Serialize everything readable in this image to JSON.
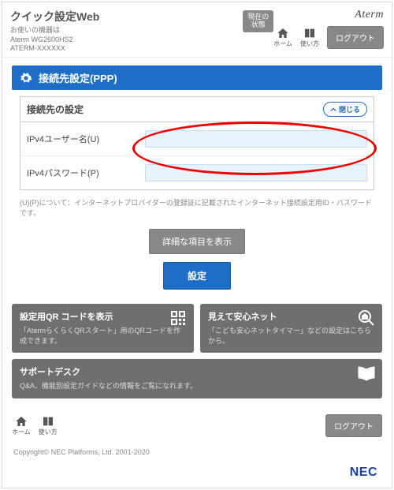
{
  "header": {
    "title": "クイック設定Web",
    "sub_label": "お使いの機器は",
    "model": "Aterm WG2600HS2",
    "serial": "ATERM-XXXXXX",
    "status_btn": "現在の\n状態",
    "brand_logo": "Aterm",
    "home_label": "ホーム",
    "usage_label": "使い方",
    "logout": "ログアウト"
  },
  "page": {
    "title": "接続先設定(PPP)"
  },
  "panel": {
    "title": "接続先の設定",
    "collapse": "閉じる",
    "ipv4_user_label": "IPv4ユーザー名(U)",
    "ipv4_user_value": "",
    "ipv4_pass_label": "IPv4パスワード(P)",
    "ipv4_pass_value": ""
  },
  "note": "(U)(P)について：インターネットプロバイダーの登録証に記載されたインターネット接続設定用ID・パスワードです。",
  "buttons": {
    "details": "詳細な項目を表示",
    "apply": "設定"
  },
  "cards": {
    "qr_title": "設定用QR コードを表示",
    "qr_desc": "「AtermらくらくQRスタート」用のQRコードを作成できます。",
    "safety_title": "見えて安心ネット",
    "safety_desc": "「こども安心ネットタイマー」などの設定はこちらから。",
    "support_title": "サポートデスク",
    "support_desc": "Q&A、機能別設定ガイドなどの情報をご覧になれます。"
  },
  "footer": {
    "home_label": "ホーム",
    "usage_label": "使い方",
    "logout": "ログアウト",
    "copyright": "Copyright© NEC Platforms, Ltd. 2001-2020",
    "nec": "NEC"
  }
}
